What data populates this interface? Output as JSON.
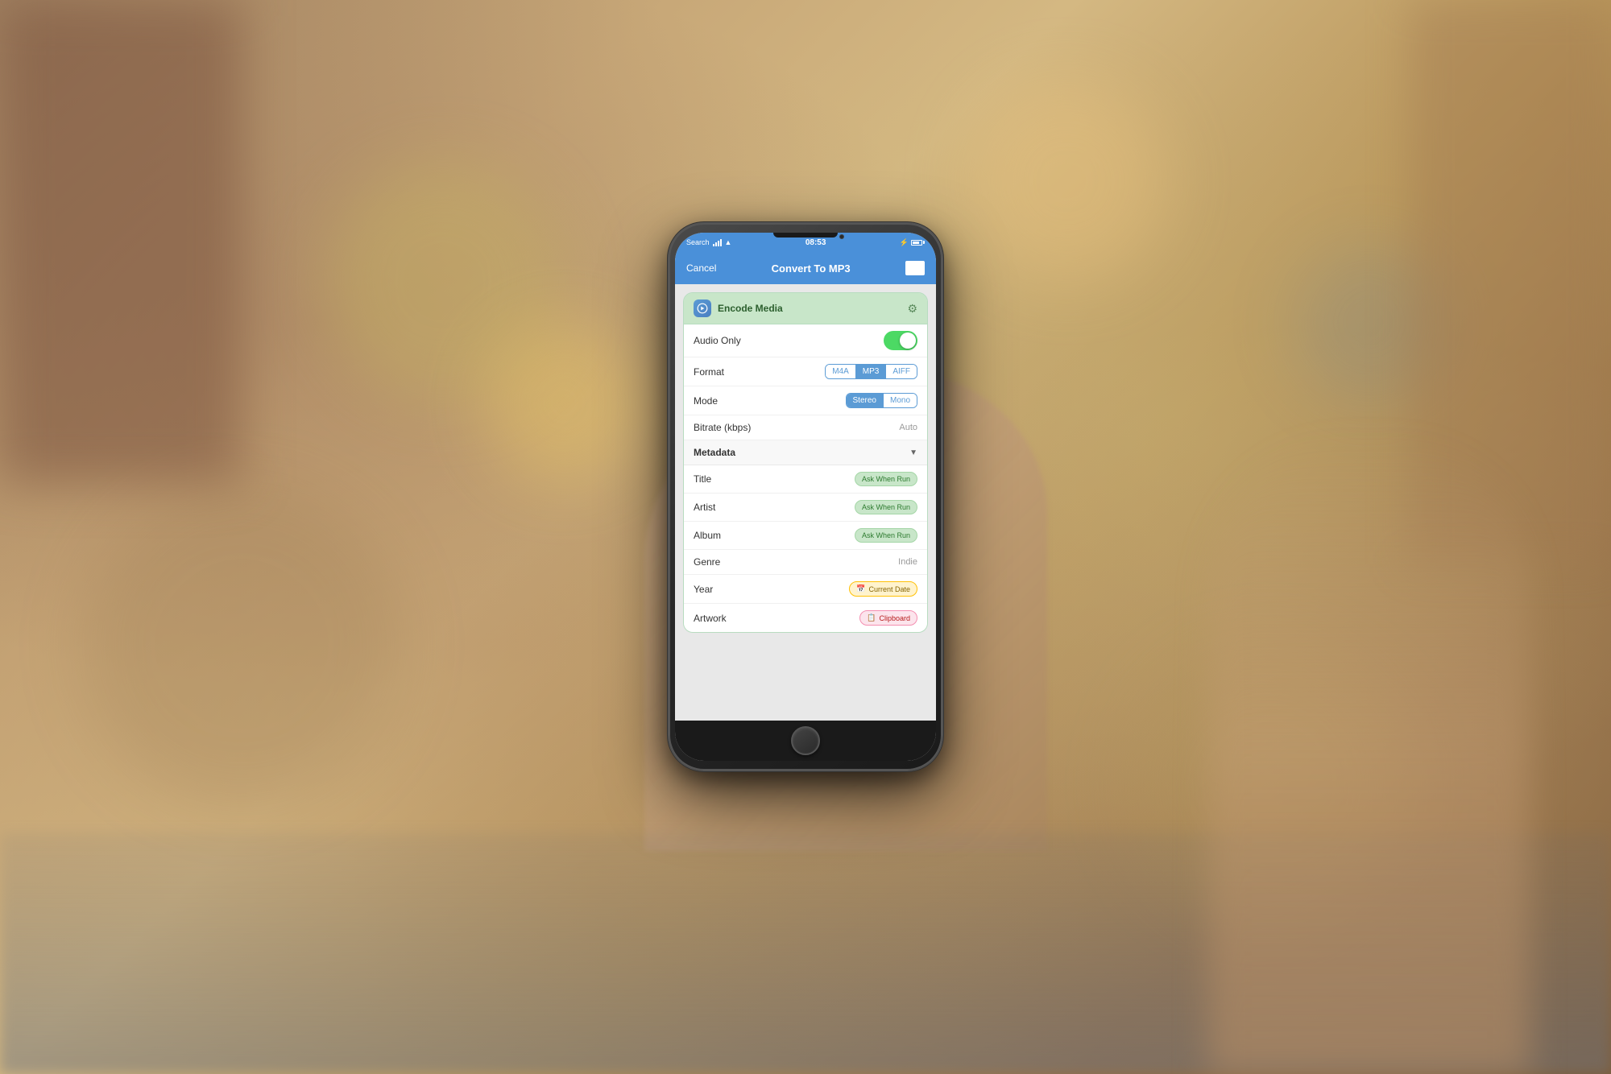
{
  "background": {
    "color_main": "#b8905a"
  },
  "phone": {
    "status_bar": {
      "carrier": "Search",
      "time": "08:53",
      "battery_percent": 85
    },
    "nav_bar": {
      "cancel_label": "Cancel",
      "title": "Convert To MP3",
      "action_label": ""
    },
    "encode_card": {
      "header_title": "Encode Media",
      "rows": [
        {
          "id": "audio_only",
          "label": "Audio Only",
          "control": "toggle",
          "value": true
        },
        {
          "id": "format",
          "label": "Format",
          "control": "segmented",
          "options": [
            "M4A",
            "MP3",
            "AIFF"
          ],
          "selected": "MP3"
        },
        {
          "id": "mode",
          "label": "Mode",
          "control": "segmented_mode",
          "options": [
            "Stereo",
            "Mono"
          ],
          "selected": "Stereo"
        },
        {
          "id": "bitrate",
          "label": "Bitrate (kbps)",
          "control": "value",
          "value": "Auto"
        },
        {
          "id": "metadata",
          "label": "Metadata",
          "control": "section_header"
        },
        {
          "id": "title",
          "label": "Title",
          "control": "badge",
          "badge_type": "ask",
          "badge_label": "Ask When Run"
        },
        {
          "id": "artist",
          "label": "Artist",
          "control": "badge",
          "badge_type": "ask",
          "badge_label": "Ask When Run"
        },
        {
          "id": "album",
          "label": "Album",
          "control": "badge",
          "badge_type": "ask",
          "badge_label": "Ask When Run"
        },
        {
          "id": "genre",
          "label": "Genre",
          "control": "value",
          "value": "Indie"
        },
        {
          "id": "year",
          "label": "Year",
          "control": "badge",
          "badge_type": "date",
          "badge_label": "Current Date"
        },
        {
          "id": "artwork",
          "label": "Artwork",
          "control": "badge",
          "badge_type": "clipboard",
          "badge_label": "Clipboard"
        }
      ]
    }
  }
}
